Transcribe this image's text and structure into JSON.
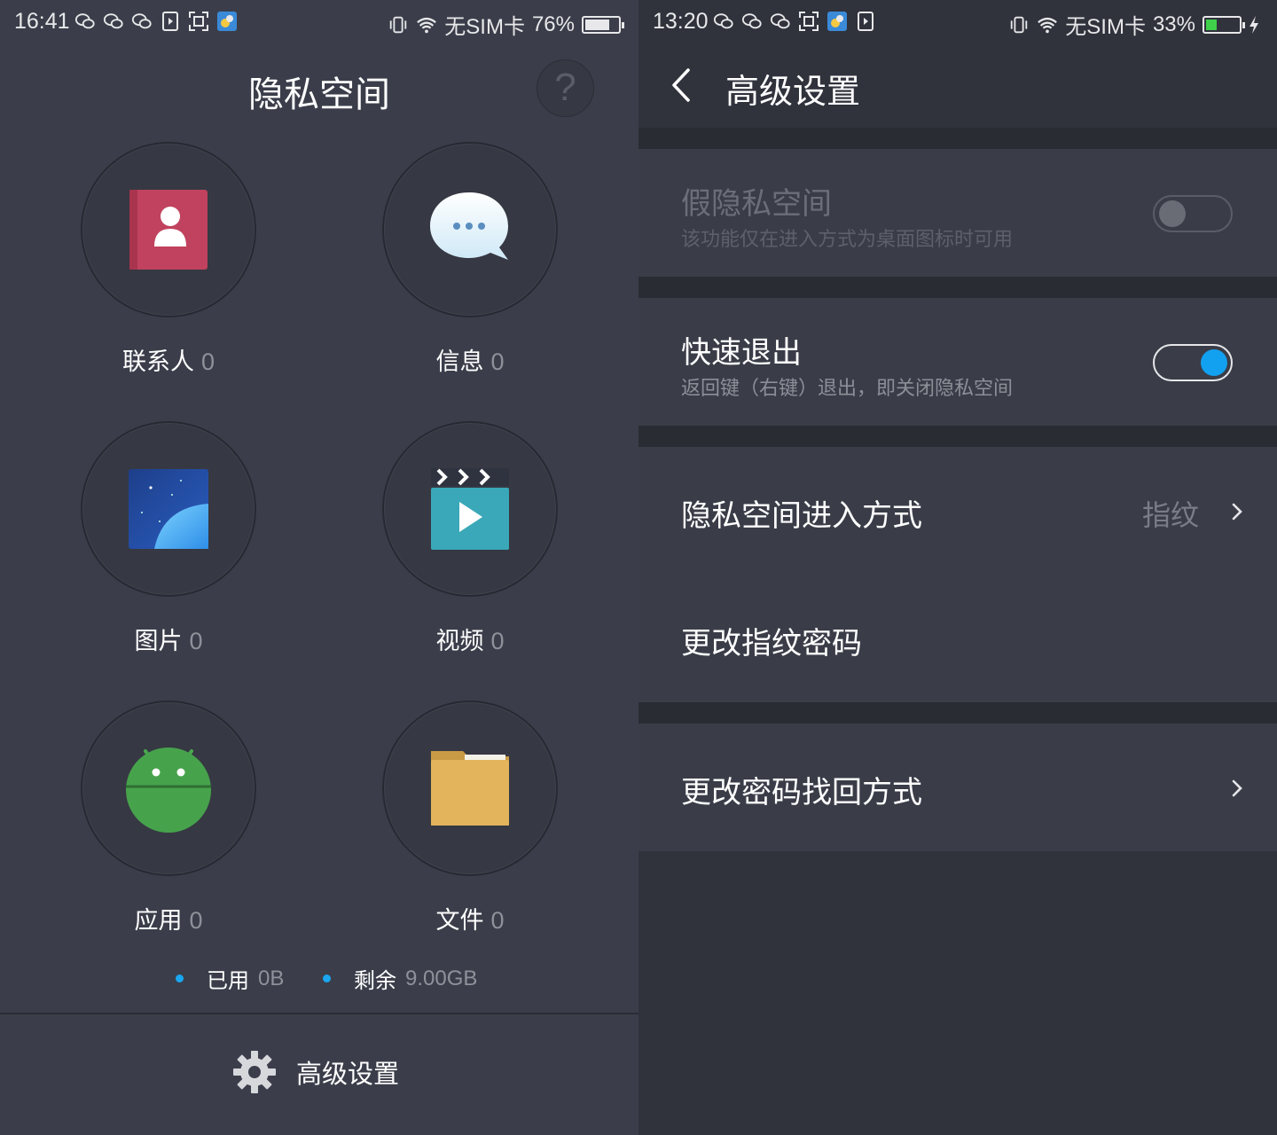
{
  "left_screen": {
    "status": {
      "time": "16:41",
      "sim": "无SIM卡",
      "battery": "76%",
      "battery_level": 0.76,
      "notification_icons": [
        "wechat-icon",
        "wechat-icon",
        "wechat-icon",
        "sim-toolkit-icon",
        "screenshot-icon",
        "weather-app-icon"
      ]
    },
    "title": "隐私空间",
    "help_symbol": "?",
    "items": [
      {
        "label": "联系人",
        "count": "0",
        "icon": "contacts-icon"
      },
      {
        "label": "信息",
        "count": "0",
        "icon": "messages-icon"
      },
      {
        "label": "图片",
        "count": "0",
        "icon": "gallery-icon"
      },
      {
        "label": "视频",
        "count": "0",
        "icon": "video-icon"
      },
      {
        "label": "应用",
        "count": "0",
        "icon": "android-app-icon"
      },
      {
        "label": "文件",
        "count": "0",
        "icon": "folder-icon"
      }
    ],
    "storage": {
      "used_label": "已用",
      "used_value": "0B",
      "remaining_label": "剩余",
      "remaining_value": "9.00GB",
      "dot_color": "#1aa6f0"
    },
    "advanced_button": "高级设置"
  },
  "right_screen": {
    "status": {
      "time": "13:20",
      "sim": "无SIM卡",
      "battery": "33%",
      "battery_level": 0.33,
      "charging": true,
      "notification_icons": [
        "wechat-icon",
        "wechat-icon",
        "wechat-icon",
        "screenshot-icon",
        "weather-app-icon",
        "sim-toolkit-icon"
      ]
    },
    "title": "高级设置",
    "settings": {
      "fake_space": {
        "title": "假隐私空间",
        "subtitle": "该功能仅在进入方式为桌面图标时可用",
        "enabled": false,
        "disabled": true
      },
      "quick_exit": {
        "title": "快速退出",
        "subtitle": "返回键（右键）退出，即关闭隐私空间",
        "enabled": true
      },
      "entry_method": {
        "title": "隐私空间进入方式",
        "value": "指纹"
      },
      "change_fingerprint": {
        "title": "更改指纹密码"
      },
      "recovery_method": {
        "title": "更改密码找回方式"
      }
    },
    "accent_color": "#12a0f0"
  }
}
